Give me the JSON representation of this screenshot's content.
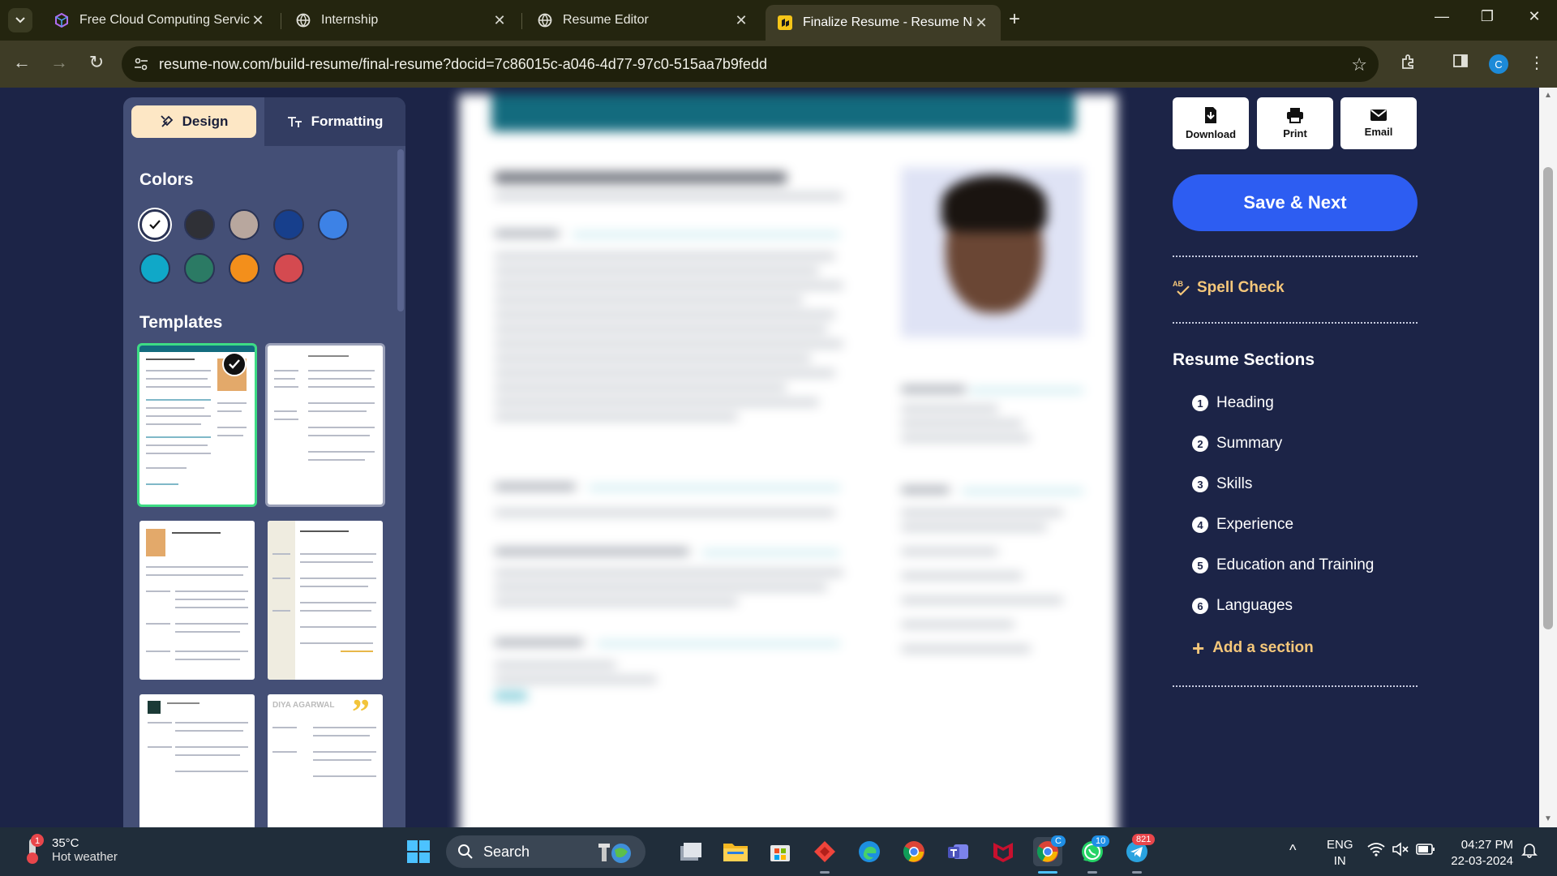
{
  "browser": {
    "tabs": [
      {
        "title": "Free Cloud Computing Services",
        "icon": "cube-icon",
        "active": false
      },
      {
        "title": "Internship",
        "icon": "globe-icon",
        "active": false
      },
      {
        "title": "Resume Editor",
        "icon": "globe-icon",
        "active": false
      },
      {
        "title": "Finalize Resume - Resume Now",
        "icon": "resume-now-icon",
        "active": true
      }
    ],
    "url": "resume-now.com/build-resume/final-resume?docid=7c86015c-a046-4d77-97c0-515aa7b9fedd",
    "profile_initial": "C"
  },
  "left_panel": {
    "design_tab": "Design",
    "formatting_tab": "Formatting",
    "colors_title": "Colors",
    "colors": [
      "#ffffff",
      "#2f3036",
      "#b8a79e",
      "#173f8c",
      "#3d82e6",
      "#10a8c8",
      "#2b7a64",
      "#f38f1b",
      "#d44a50"
    ],
    "selected_color_index": 0,
    "templates_title": "Templates",
    "selected_template_index": 0,
    "template_6_name": "DIYA AGARWAL"
  },
  "actions": {
    "download": "Download",
    "print": "Print",
    "email": "Email",
    "save_next": "Save & Next",
    "spell_check": "Spell Check",
    "spell_icon_text": "AB"
  },
  "resume_sections": {
    "title": "Resume Sections",
    "items": [
      {
        "num": "1",
        "label": "Heading"
      },
      {
        "num": "2",
        "label": "Summary"
      },
      {
        "num": "3",
        "label": "Skills"
      },
      {
        "num": "4",
        "label": "Experience"
      },
      {
        "num": "5",
        "label": "Education and Training"
      },
      {
        "num": "6",
        "label": "Languages"
      }
    ],
    "add_section": "Add a section"
  },
  "taskbar": {
    "weather_temp": "35°C",
    "weather_desc": "Hot weather",
    "weather_alert": "1",
    "search_placeholder": "Search",
    "whatsapp_badge": "10",
    "telegram_badge": "821",
    "chrome_badge": "C",
    "lang_1": "ENG",
    "lang_2": "IN",
    "time": "04:27 PM",
    "date": "22-03-2024"
  }
}
